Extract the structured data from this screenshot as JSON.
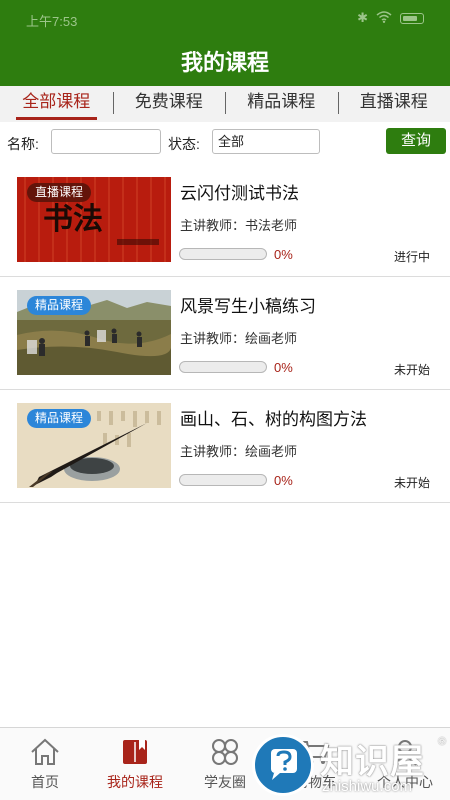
{
  "status_bar": {
    "time": "上午7:53"
  },
  "header": {
    "title": "我的课程"
  },
  "tabs": [
    {
      "label": "全部课程",
      "active": true
    },
    {
      "label": "免费课程",
      "active": false
    },
    {
      "label": "精品课程",
      "active": false
    },
    {
      "label": "直播课程",
      "active": false
    }
  ],
  "filter": {
    "name_label": "名称:",
    "name_value": "",
    "status_label": "状态:",
    "status_value": "全部",
    "query_button": "查询"
  },
  "courses": [
    {
      "badge": "直播课程",
      "title": "云闪付测试书法",
      "teacher": "主讲教师：书法老师",
      "progress_percent": 0,
      "progress_label": "0%",
      "status": "进行中",
      "thumb_text": "书法"
    },
    {
      "badge": "精品课程",
      "title": "风景写生小稿练习",
      "teacher": "主讲教师：绘画老师",
      "progress_percent": 0,
      "progress_label": "0%",
      "status": "未开始"
    },
    {
      "badge": "精品课程",
      "title": "画山、石、树的构图方法",
      "teacher": "主讲教师：绘画老师",
      "progress_percent": 0,
      "progress_label": "0%",
      "status": "未开始"
    }
  ],
  "tabbar": [
    {
      "label": "首页",
      "icon": "home-icon",
      "active": false
    },
    {
      "label": "我的课程",
      "icon": "book-icon",
      "active": true
    },
    {
      "label": "学友圈",
      "icon": "clover-icon",
      "active": false
    },
    {
      "label": "购物车",
      "icon": "cart-icon",
      "active": false
    },
    {
      "label": "个人中心",
      "icon": "person-icon",
      "active": false
    }
  ],
  "watermark": {
    "brand": "知识屋",
    "registered": "®",
    "url": "zhishiwu.com"
  },
  "colors": {
    "primary_green": "#2e7d0f",
    "accent_red": "#a8241a",
    "badge_blue": "#2c86d9"
  }
}
